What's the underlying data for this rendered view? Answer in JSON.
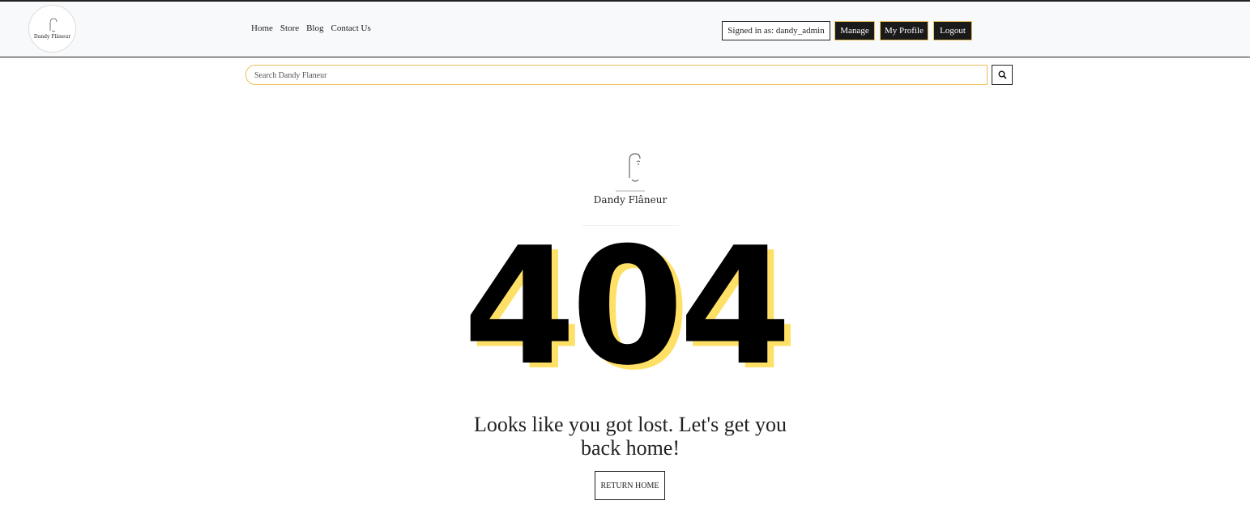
{
  "header": {
    "logo_text": "Dandy Flâneur",
    "nav": [
      {
        "label": "Home"
      },
      {
        "label": "Store"
      },
      {
        "label": "Blog"
      },
      {
        "label": "Contact Us"
      }
    ],
    "signed_in": "Signed in as: dandy_admin",
    "buttons": {
      "manage": "Manage",
      "profile": "My Profile",
      "logout": "Logout"
    }
  },
  "search": {
    "placeholder": "Search Dandy Flaneur",
    "icon": "search-icon"
  },
  "main": {
    "brand_text": "Dandy Flâneur",
    "error_code": "404",
    "message": "Looks like you got lost. Let's get you back home!",
    "return_button": "RETURN HOME"
  },
  "colors": {
    "accent": "#ffe066",
    "border_accent": "#e8c15a",
    "dark": "#1a1a1a"
  }
}
